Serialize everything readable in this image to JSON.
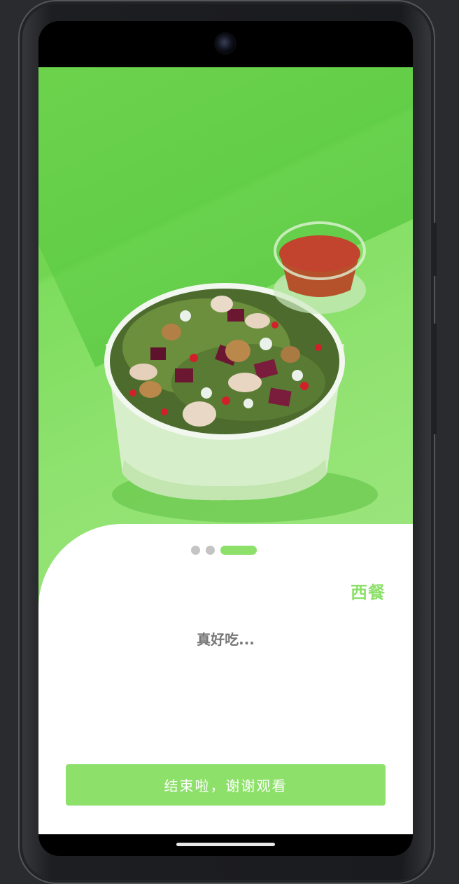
{
  "onboarding": {
    "page_indicator": {
      "total": 3,
      "current": 3
    },
    "category_title": "西餐",
    "description": "真好吃...",
    "finish_button_label": "结束啦，谢谢观看"
  },
  "colors": {
    "accent": "#8de06a",
    "background_green": "#7ddd5d",
    "inactive_dot": "#c4c4c4",
    "description_text": "#777777"
  },
  "icons": {
    "camera": "front-camera-icon",
    "home": "home-indicator-icon"
  }
}
